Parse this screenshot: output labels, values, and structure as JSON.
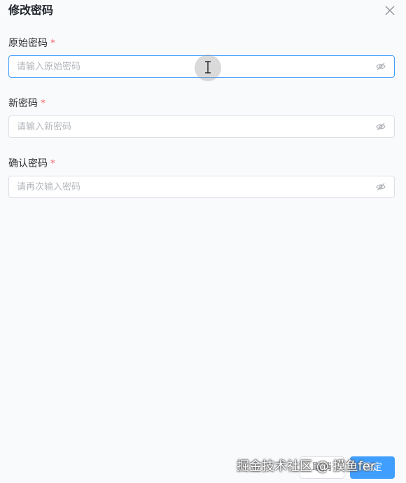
{
  "dialog": {
    "title": "修改密码",
    "close_icon": "close-icon"
  },
  "form": {
    "required_mark": "*",
    "fields": [
      {
        "label": "原始密码",
        "placeholder": "请输入原始密码",
        "value": "",
        "focused": true,
        "icon": "eye-off-icon"
      },
      {
        "label": "新密码",
        "placeholder": "请输入新密码",
        "value": "",
        "focused": false,
        "icon": "eye-off-icon"
      },
      {
        "label": "确认密码",
        "placeholder": "请再次输入密码",
        "value": "",
        "focused": false,
        "icon": "eye-off-icon"
      }
    ]
  },
  "footer": {
    "cancel_label": "取消",
    "ok_label": "确定"
  },
  "watermark": {
    "text": "掘金技术社区 @ 摸鱼fer"
  },
  "colors": {
    "accent": "#409eff",
    "required": "#f56c6c",
    "border": "#dcdfe6",
    "background": "#f9fafc"
  }
}
